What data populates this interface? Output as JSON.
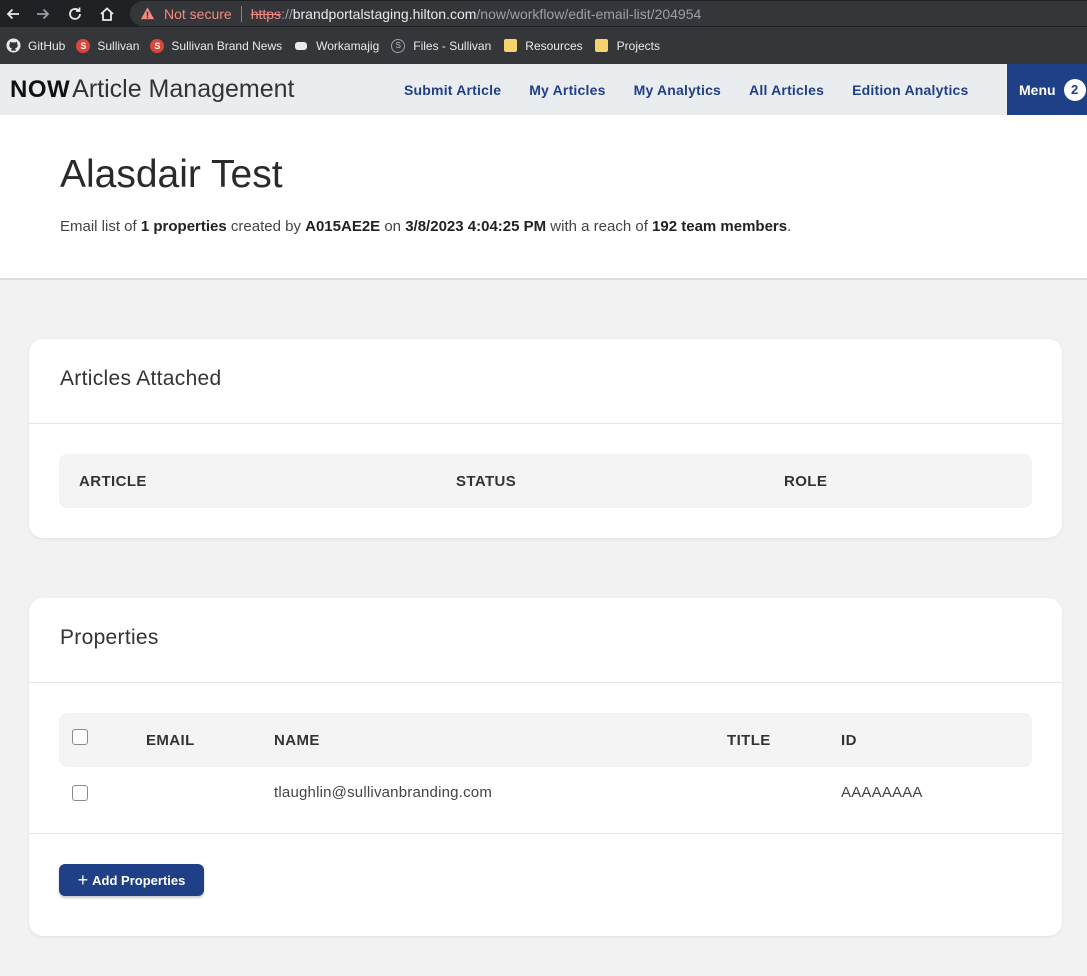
{
  "browser": {
    "not_secure": "Not secure",
    "url_scheme": "https",
    "url_sep": "://",
    "url_host": "brandportalstaging.hilton.com",
    "url_path": "/now/workflow/edit-email-list/204954",
    "bookmarks": [
      {
        "label": "GitHub",
        "icon": "github-icon"
      },
      {
        "label": "Sullivan",
        "icon": "s-icon"
      },
      {
        "label": "Sullivan Brand News",
        "icon": "s-icon"
      },
      {
        "label": "Workamajig",
        "icon": "workamajig-icon"
      },
      {
        "label": "Files - Sullivan",
        "icon": "files-icon"
      },
      {
        "label": "Resources",
        "icon": "folder-icon"
      },
      {
        "label": "Projects",
        "icon": "folder-icon"
      }
    ]
  },
  "header": {
    "brand_now": "NOW",
    "brand_title": "Article Management",
    "nav": [
      "Submit Article",
      "My Articles",
      "My Analytics",
      "All Articles",
      "Edition Analytics"
    ],
    "menu_label": "Menu",
    "menu_badge": "2"
  },
  "page": {
    "title": "Alasdair Test",
    "meta": {
      "t1": "Email list of ",
      "count": "1 properties",
      "t2": " created by ",
      "creator": "A015AE2E",
      "t3": " on ",
      "date": "3/8/2023 4:04:25 PM",
      "t4": " with a reach of ",
      "reach": "192 team members",
      "t5": "."
    }
  },
  "articles_card": {
    "title": "Articles Attached",
    "columns": [
      "ARTICLE",
      "STATUS",
      "ROLE"
    ]
  },
  "properties_card": {
    "title": "Properties",
    "columns": [
      "EMAIL",
      "NAME",
      "TITLE",
      "ID"
    ],
    "rows": [
      {
        "email": "",
        "name": "tlaughlin@sullivanbranding.com",
        "title": "",
        "id": "AAAAAAAA"
      }
    ],
    "add_button": "Add Properties"
  },
  "colors": {
    "primary": "#1f3f86",
    "warning": "#f28b82"
  }
}
